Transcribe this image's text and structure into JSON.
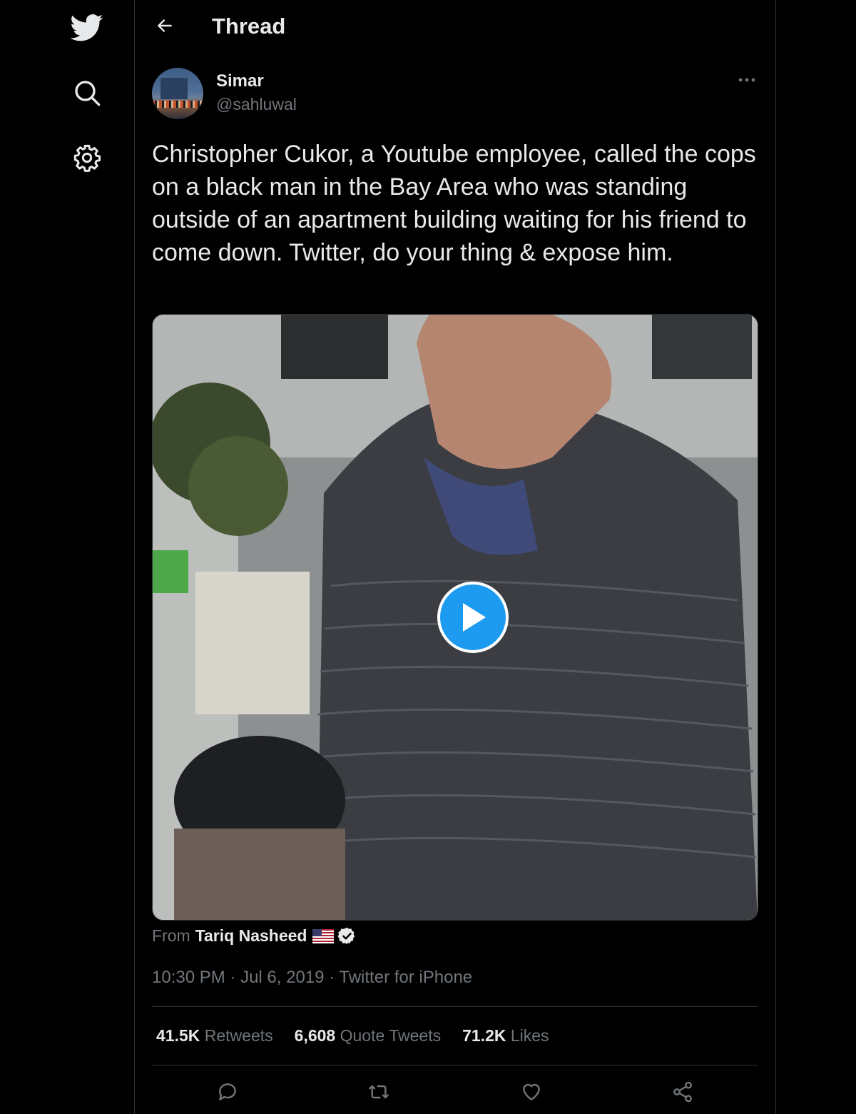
{
  "header": {
    "title": "Thread"
  },
  "tweet": {
    "author_name": "Simar",
    "author_handle": "@sahluwal",
    "text": "Christopher Cukor, a Youtube employee, called the cops on a black man in the Bay Area who was standing outside of an apartment building waiting for his friend to come down. Twitter, do your thing & expose him.",
    "media_source_prefix": "From",
    "media_source_name": "Tariq Nasheed",
    "time": "10:30 PM",
    "date": "Jul 6, 2019",
    "client": "Twitter for iPhone",
    "sep": " · "
  },
  "stats": {
    "retweets_count": "41.5K",
    "retweets_label": "Retweets",
    "quotes_count": "6,608",
    "quotes_label": "Quote Tweets",
    "likes_count": "71.2K",
    "likes_label": "Likes"
  },
  "colors": {
    "accent": "#1d9bf0",
    "background": "#000000",
    "secondary_text": "#71767b",
    "border": "#2f3336"
  },
  "icons": [
    "twitter-bird-icon",
    "search-icon",
    "gear-icon",
    "back-arrow-icon",
    "more-icon",
    "play-icon",
    "us-flag-icon",
    "verified-icon",
    "reply-icon",
    "retweet-icon",
    "like-icon",
    "share-icon"
  ]
}
